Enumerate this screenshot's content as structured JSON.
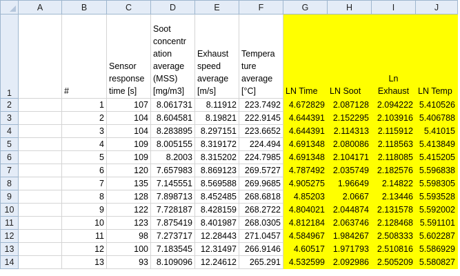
{
  "columns": [
    "A",
    "B",
    "C",
    "D",
    "E",
    "F",
    "G",
    "H",
    "I",
    "J"
  ],
  "header_row_number": "1",
  "headers": {
    "A": "",
    "B": "#",
    "C": "Sensor response time [s]",
    "D": "Soot concentration average (MSS) [mg/m3]",
    "E": "Exhaust speed average [m/s]",
    "F": "Temperature average [°C]",
    "G": "LN Time",
    "H": "LN Soot",
    "I": "Ln Exhaust",
    "J": "LN Temp"
  },
  "header_lines": {
    "C": [
      "Sensor",
      "response",
      "time [s]"
    ],
    "D": [
      "Soot",
      "concentr",
      "ation",
      "average",
      "(MSS)",
      "[mg/m3]"
    ],
    "E": [
      "Exhaust",
      "speed",
      "average",
      "[m/s]"
    ],
    "F": [
      "Tempera",
      "ture",
      "average",
      "[°C]"
    ],
    "I": [
      "Ln",
      "Exhaust"
    ]
  },
  "highlight_color": "#ffff00",
  "rows": [
    {
      "row": "2",
      "B": "1",
      "C": "107",
      "D": "8.061731",
      "E": "8.11912",
      "F": "223.7492",
      "G": "4.672829",
      "H": "2.087128",
      "I": "2.094222",
      "J": "5.410526"
    },
    {
      "row": "3",
      "B": "2",
      "C": "104",
      "D": "8.604581",
      "E": "8.19821",
      "F": "222.9145",
      "G": "4.644391",
      "H": "2.152295",
      "I": "2.103916",
      "J": "5.406788"
    },
    {
      "row": "4",
      "B": "3",
      "C": "104",
      "D": "8.283895",
      "E": "8.297151",
      "F": "223.6652",
      "G": "4.644391",
      "H": "2.114313",
      "I": "2.115912",
      "J": "5.41015"
    },
    {
      "row": "5",
      "B": "4",
      "C": "109",
      "D": "8.005155",
      "E": "8.319172",
      "F": "224.494",
      "G": "4.691348",
      "H": "2.080086",
      "I": "2.118563",
      "J": "5.413849"
    },
    {
      "row": "6",
      "B": "5",
      "C": "109",
      "D": "8.2003",
      "E": "8.315202",
      "F": "224.7985",
      "G": "4.691348",
      "H": "2.104171",
      "I": "2.118085",
      "J": "5.415205"
    },
    {
      "row": "7",
      "B": "6",
      "C": "120",
      "D": "7.657983",
      "E": "8.869123",
      "F": "269.5727",
      "G": "4.787492",
      "H": "2.035749",
      "I": "2.182576",
      "J": "5.596838"
    },
    {
      "row": "8",
      "B": "7",
      "C": "135",
      "D": "7.145551",
      "E": "8.569588",
      "F": "269.9685",
      "G": "4.905275",
      "H": "1.96649",
      "I": "2.14822",
      "J": "5.598305"
    },
    {
      "row": "9",
      "B": "8",
      "C": "128",
      "D": "7.898713",
      "E": "8.452485",
      "F": "268.6818",
      "G": "4.85203",
      "H": "2.0667",
      "I": "2.13446",
      "J": "5.593528"
    },
    {
      "row": "10",
      "B": "9",
      "C": "122",
      "D": "7.728187",
      "E": "8.428159",
      "F": "268.2722",
      "G": "4.804021",
      "H": "2.044874",
      "I": "2.131578",
      "J": "5.592002"
    },
    {
      "row": "11",
      "B": "10",
      "C": "123",
      "D": "7.875419",
      "E": "8.401987",
      "F": "268.0305",
      "G": "4.812184",
      "H": "2.063746",
      "I": "2.128468",
      "J": "5.591101"
    },
    {
      "row": "12",
      "B": "11",
      "C": "98",
      "D": "7.273717",
      "E": "12.28443",
      "F": "271.0457",
      "G": "4.584967",
      "H": "1.984267",
      "I": "2.508333",
      "J": "5.602287"
    },
    {
      "row": "13",
      "B": "12",
      "C": "100",
      "D": "7.183545",
      "E": "12.31497",
      "F": "266.9146",
      "G": "4.60517",
      "H": "1.971793",
      "I": "2.510816",
      "J": "5.586929"
    },
    {
      "row": "14",
      "B": "13",
      "C": "93",
      "D": "8.109096",
      "E": "12.24612",
      "F": "265.291",
      "G": "4.532599",
      "H": "2.092986",
      "I": "2.505209",
      "J": "5.580827"
    }
  ]
}
